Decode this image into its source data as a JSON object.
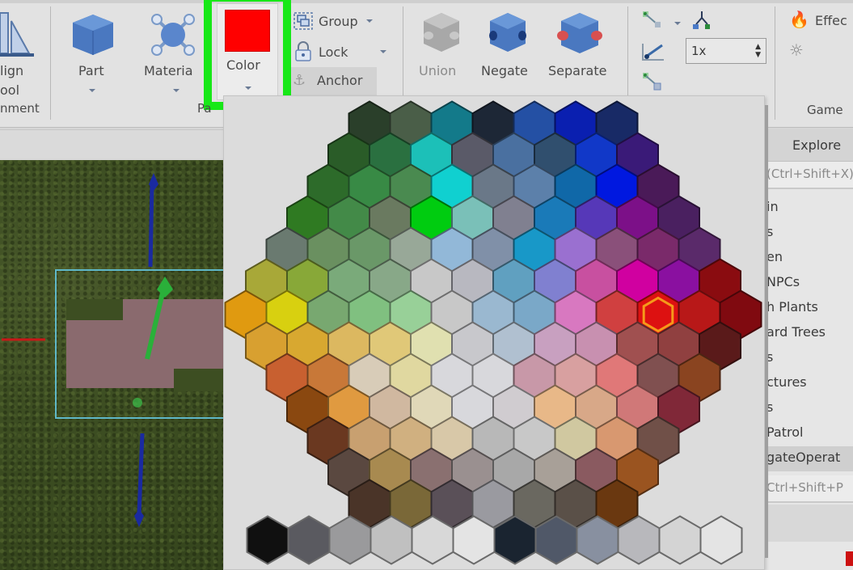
{
  "ribbon": {
    "align_tool": {
      "label_line1": "lign",
      "label_line2": "ool"
    },
    "alignment_group_label": "nment",
    "part": {
      "label": "Part"
    },
    "material": {
      "label": "Materia"
    },
    "color": {
      "label": "Color",
      "value": "#ff0000"
    },
    "part_group_label": "Pa",
    "group": {
      "label": "Group"
    },
    "lock": {
      "label": "Lock"
    },
    "anchor": {
      "label": "Anchor"
    },
    "union": {
      "label": "Union"
    },
    "negate": {
      "label": "Negate"
    },
    "separate": {
      "label": "Separate"
    },
    "step_value": "1x",
    "effects": {
      "label": "Effec"
    },
    "gameplay_group_label": "Game"
  },
  "explorer": {
    "header": "Explore",
    "filter_placeholder": "(Ctrl+Shift+X)",
    "items": [
      {
        "label": "in"
      },
      {
        "label": "s"
      },
      {
        "label": "en"
      },
      {
        "label": "NPCs"
      },
      {
        "label": "h Plants"
      },
      {
        "label": "ard Trees"
      },
      {
        "label": "s"
      },
      {
        "label": "ctures"
      },
      {
        "label": "s"
      },
      {
        "label": "Patrol"
      },
      {
        "label": "gateOperat",
        "selected": true
      }
    ],
    "properties_filter_placeholder": "Ctrl+Shift+P"
  },
  "color_picker": {
    "selected": {
      "row": 6,
      "col": 10,
      "color": "#dd1111"
    },
    "selected_outline": "#f59a1a",
    "rows": [
      [
        "#2a3f2a",
        "#4a5e48",
        "#137a8a",
        "#1d2736",
        "#2450a4",
        "#0a1fb0",
        "#182a66"
      ],
      [
        "#2a5c28",
        "#2a7040",
        "#1cc0b8",
        "#5a5a68",
        "#4a70a0",
        "#304f6e",
        "#1138c8",
        "#3a1a78"
      ],
      [
        "#2d6b2a",
        "#388a45",
        "#4a8a50",
        "#10d0d0",
        "#6a7888",
        "#5c80aa",
        "#1068a8",
        "#0018e0",
        "#4a1a58"
      ],
      [
        "#2f7a22",
        "#438a48",
        "#6a7a60",
        "#00cc10",
        "#7ac0b8",
        "#808090",
        "#1a7ab8",
        "#5638b8",
        "#7c1088",
        "#4a2060"
      ],
      [
        "#6a7a70",
        "#6a9060",
        "#6a9868",
        "#98a898",
        "#92b8d8",
        "#8090a8",
        "#1898c8",
        "#9a70d0",
        "#8a507a",
        "#7a2a6a",
        "#5a2a6a"
      ],
      [
        "#a8a838",
        "#88a838",
        "#7aaa7a",
        "#88a888",
        "#c8c8c8",
        "#b8b8c0",
        "#60a0c0",
        "#8080d0",
        "#c850a0",
        "#d000a0",
        "#8a10a0",
        "#8a0c10"
      ],
      [
        "#e09a10",
        "#d8d010",
        "#78a870",
        "#80c080",
        "#98d098",
        "#c8c8c8",
        "#9ab8d0",
        "#7aa8c8",
        "#d878c0",
        "#d04040",
        "#dd1111",
        "#b81818",
        "#800a10"
      ],
      [
        "#d8a030",
        "#d8a830",
        "#dcb860",
        "#e0c878",
        "#e0e0b0",
        "#c8c8cc",
        "#b0c0d0",
        "#c8a0c0",
        "#c890b0",
        "#a05050",
        "#904040",
        "#5a1a1a"
      ],
      [
        "#c86030",
        "#c87838",
        "#d8ccb8",
        "#e0d8a0",
        "#d8d8dc",
        "#d8d8dc",
        "#c898a8",
        "#d8a0a0",
        "#e07878",
        "#805050",
        "#8a4420"
      ],
      [
        "#8a4810",
        "#e09a40",
        "#d0b8a0",
        "#e0d8b8",
        "#d8d8dc",
        "#d0ccd0",
        "#e8b888",
        "#d8a888",
        "#d07878",
        "#802838"
      ],
      [
        "#6a3820",
        "#c8a070",
        "#d0b080",
        "#d8c8a8",
        "#b8b8b8",
        "#c8c8c8",
        "#d0c8a0",
        "#d89870",
        "#705048"
      ],
      [
        "#5a4840",
        "#a88a50",
        "#8a7070",
        "#9a9090",
        "#a8a8a8",
        "#a8a098",
        "#8a5a60",
        "#9a5420"
      ],
      [
        "#4a3428",
        "#7a6838",
        "#5a5058",
        "#9a9aa0",
        "#6a6860",
        "#5a5048",
        "#6a3810"
      ]
    ],
    "grays": [
      "#101010",
      "#5a5a60",
      "#9a9a9c",
      "#c0c0c0",
      "#d8d8d8",
      "#e4e4e4",
      "#1a2430",
      "#505868",
      "#8890a0",
      "#b8b8bc",
      "#d4d4d4",
      "#e4e4e4"
    ]
  }
}
